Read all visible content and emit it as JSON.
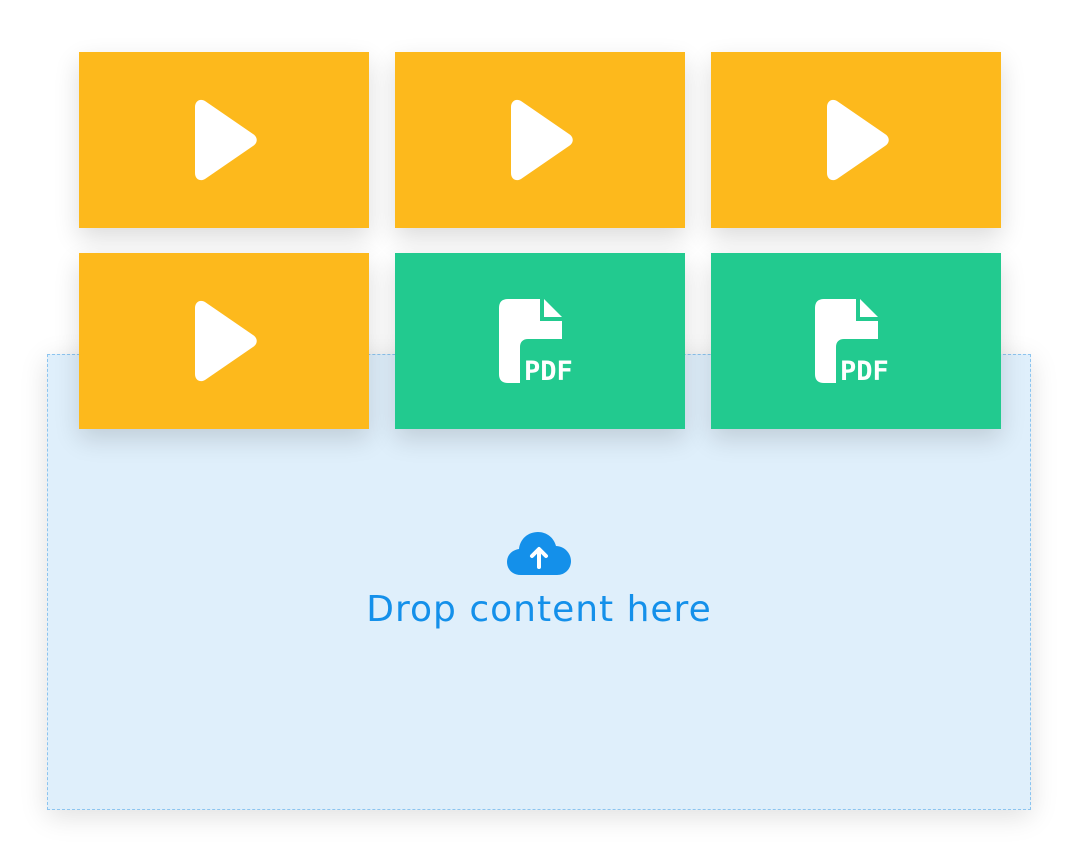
{
  "dropzone": {
    "label": "Drop content here",
    "icon": "cloud-upload-icon",
    "color": "#1490ea",
    "background": "#dfeffb",
    "border_color": "#8cc4ef"
  },
  "tiles": [
    {
      "type": "video",
      "icon": "play-icon",
      "color": "#fdb91c"
    },
    {
      "type": "video",
      "icon": "play-icon",
      "color": "#fdb91c"
    },
    {
      "type": "video",
      "icon": "play-icon",
      "color": "#fdb91c"
    },
    {
      "type": "video",
      "icon": "play-icon",
      "color": "#fdb91c"
    },
    {
      "type": "pdf",
      "icon": "pdf-file-icon",
      "label": "PDF",
      "color": "#22ca8f"
    },
    {
      "type": "pdf",
      "icon": "pdf-file-icon",
      "label": "PDF",
      "color": "#22ca8f"
    }
  ]
}
